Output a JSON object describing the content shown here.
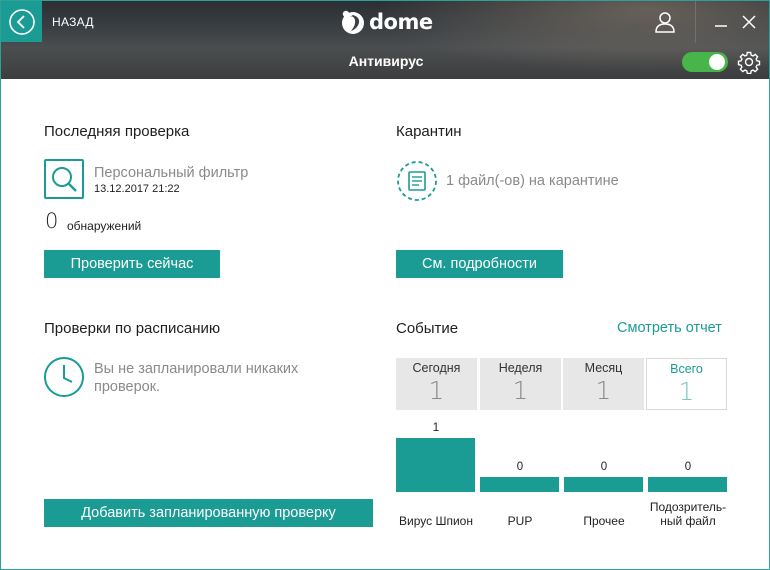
{
  "header": {
    "back_label": "НАЗАД",
    "logo_text": "dome",
    "section_title": "Антивирус",
    "toggle_on": true,
    "accent_color": "#1a9c95",
    "toggle_color": "#48b54a"
  },
  "last_scan": {
    "title": "Последняя проверка",
    "scan_name": "Персональный фильтр",
    "scan_date": "13.12.2017 21:22",
    "detections_count": "0",
    "detections_label": "обнаружений",
    "button_label": "Проверить сейчас"
  },
  "quarantine": {
    "title": "Карантин",
    "text": "1 файл(-ов) на карантине",
    "button_label": "См. подробности"
  },
  "scheduled": {
    "title": "Проверки по расписанию",
    "text": "Вы не запланировали никаких проверок.",
    "button_label": "Добавить запланированную проверку"
  },
  "events": {
    "title": "Событие",
    "report_link": "Смотреть отчет",
    "tabs": [
      {
        "label": "Сегодня",
        "count": "1",
        "active": false
      },
      {
        "label": "Неделя",
        "count": "1",
        "active": false
      },
      {
        "label": "Месяц",
        "count": "1",
        "active": false
      },
      {
        "label": "Всего",
        "count": "1",
        "active": true
      }
    ]
  },
  "chart_data": {
    "type": "bar",
    "title": "",
    "categories": [
      "Вирус Шпион",
      "PUP",
      "Прочее",
      "Подозрительный файл"
    ],
    "category_display": [
      "Вирус Шпион",
      "PUP",
      "Прочее",
      "Подозрител­ь- ный файл"
    ],
    "values": [
      1,
      0,
      0,
      0
    ],
    "value_labels": [
      "1",
      "0",
      "0",
      "0"
    ],
    "xlabel": "",
    "ylabel": "",
    "ylim": [
      0,
      1
    ],
    "grid": false,
    "bar_color": "#1a9c95"
  }
}
